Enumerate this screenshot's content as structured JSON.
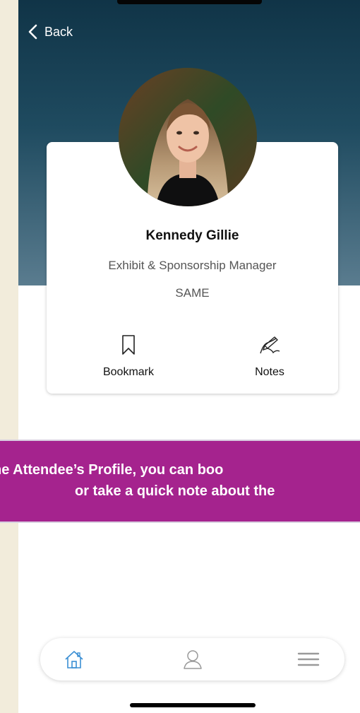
{
  "header": {
    "back_label": "Back"
  },
  "profile": {
    "name": "Kennedy Gillie",
    "title": "Exhibit & Sponsorship Manager",
    "organization": "SAME"
  },
  "actions": {
    "bookmark_label": "Bookmark",
    "notes_label": "Notes"
  },
  "banner": {
    "line1": "he Attendee’s Profile, you can boo",
    "line2": "or take a quick note about the"
  },
  "tabs": [
    {
      "icon": "home-icon"
    },
    {
      "icon": "person-icon"
    },
    {
      "icon": "menu-icon"
    }
  ],
  "colors": {
    "header_top": "#103447",
    "header_bottom": "#5a7c8f",
    "banner": "#a5238e",
    "tab_active": "#3b8fd4",
    "tab_inactive": "#9a9a9a"
  }
}
